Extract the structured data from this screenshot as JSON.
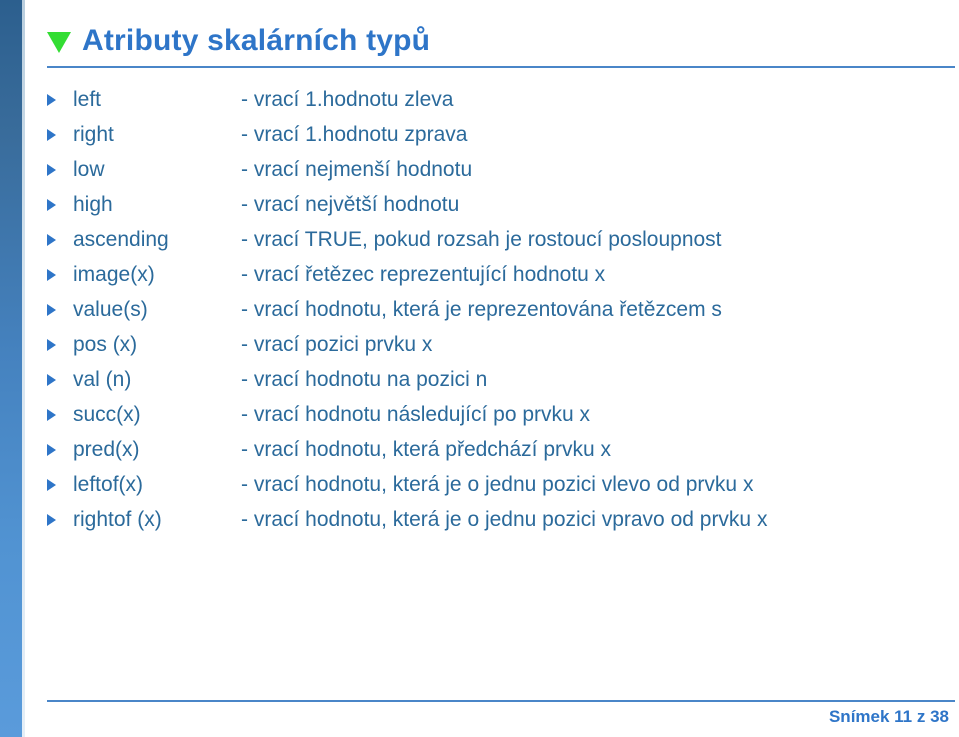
{
  "slide": {
    "title": "Atributy skalárních typů",
    "title_marker_color": "#33DD33",
    "title_color": "#2E75C8",
    "rule_color": "#4A86C8",
    "body_text_color": "#2B6A9B",
    "sidebar_gradient_top": "#2C5F8E",
    "sidebar_gradient_bottom": "#5A9BDB",
    "footer": "Snímek 11 z 38"
  },
  "attributes": [
    {
      "name": "left",
      "desc": "- vrací 1.hodnotu zleva"
    },
    {
      "name": "right",
      "desc": "- vrací 1.hodnotu zprava"
    },
    {
      "name": "low",
      "desc": "- vrací nejmenší hodnotu"
    },
    {
      "name": "high",
      "desc": "- vrací největší hodnotu"
    },
    {
      "name": "ascending",
      "desc": "- vrací TRUE, pokud rozsah je rostoucí posloupnost"
    },
    {
      "name": "image(x)",
      "desc": "- vrací řetězec reprezentující hodnotu x"
    },
    {
      "name": "value(s)",
      "desc": "- vrací hodnotu, která je reprezentována řetězcem s"
    },
    {
      "name": "pos (x)",
      "desc": "- vrací pozici prvku x"
    },
    {
      "name": "val (n)",
      "desc": "- vrací hodnotu na pozici n"
    },
    {
      "name": "succ(x)",
      "desc": "- vrací hodnotu následující po prvku x"
    },
    {
      "name": "pred(x)",
      "desc": "- vrací hodnotu, která předchází prvku x"
    },
    {
      "name": "leftof(x)",
      "desc": "- vrací hodnotu, která je o jednu pozici vlevo od prvku x"
    },
    {
      "name": "rightof (x)",
      "desc": "- vrací hodnotu, která je o jednu pozici vpravo od prvku x"
    }
  ]
}
